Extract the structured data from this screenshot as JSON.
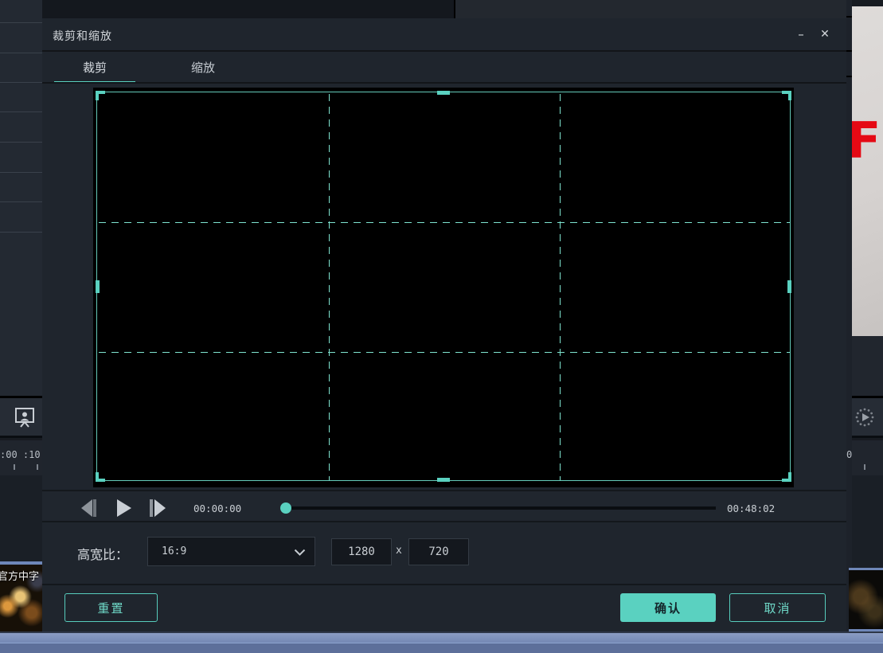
{
  "theme": {
    "accent": "#5ad1c0",
    "dialog_bg": "#1f252d",
    "netflix_red": "#e50914",
    "timeline_blue": "#7d92bd"
  },
  "dialog": {
    "title": "裁剪和缩放",
    "minimize_glyph": "–",
    "close_glyph": "✕",
    "tabs": [
      {
        "label": "裁剪",
        "active": true
      },
      {
        "label": "缩放",
        "active": false
      }
    ],
    "transport": {
      "current_time": "00:00:00",
      "duration": "00:48:02"
    },
    "aspect": {
      "label": "高宽比：",
      "ratio_value": "16:9",
      "width_value": "1280",
      "separator": "x",
      "height_value": "720"
    },
    "footer": {
      "reset_label": "重置",
      "confirm_label": "确认",
      "cancel_label": "取消"
    }
  },
  "background": {
    "left_ruler_fragment": ":00 :10:",
    "right_ruler_fragment": "0",
    "clip_label": "官方中字",
    "thumbnail_letters": "FL"
  }
}
